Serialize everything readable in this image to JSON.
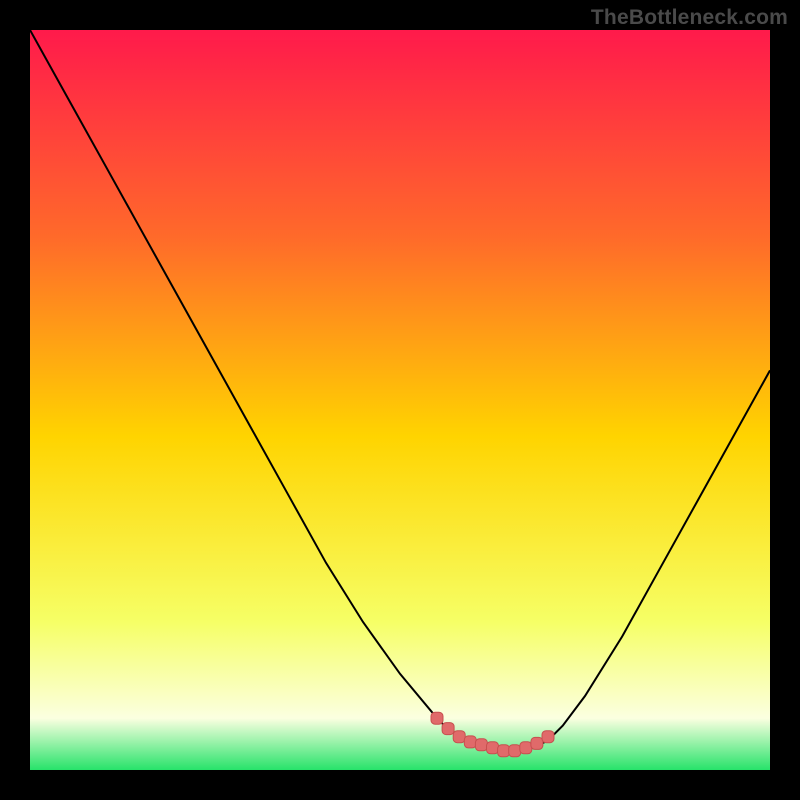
{
  "watermark": "TheBottleneck.com",
  "colors": {
    "bg_black": "#000000",
    "grad_top": "#ff1a4b",
    "grad_mid_upper": "#ff6a2a",
    "grad_mid": "#ffd400",
    "grad_lower": "#f6ff66",
    "grad_bottom_pale": "#fbffe0",
    "grad_bottom_green": "#27e36a",
    "curve_stroke": "#000000",
    "marker_fill": "#e06a6a",
    "marker_stroke": "#c74f4f"
  },
  "chart_data": {
    "type": "line",
    "title": "",
    "xlabel": "",
    "ylabel": "",
    "xlim": [
      0,
      100
    ],
    "ylim": [
      0,
      100
    ],
    "series": [
      {
        "name": "bottleneck-curve",
        "x": [
          0,
          5,
          10,
          15,
          20,
          25,
          30,
          35,
          40,
          45,
          50,
          55,
          56,
          58,
          60,
          62,
          64,
          66,
          68,
          70,
          72,
          75,
          80,
          85,
          90,
          95,
          100
        ],
        "y": [
          100,
          91,
          82,
          73,
          64,
          55,
          46,
          37,
          28,
          20,
          13,
          7,
          6,
          4.5,
          3.4,
          2.8,
          2.6,
          2.6,
          3,
          4,
          6,
          10,
          18,
          27,
          36,
          45,
          54
        ]
      }
    ],
    "markers": {
      "name": "highlight-range",
      "x": [
        55,
        56.5,
        58,
        59.5,
        61,
        62.5,
        64,
        65.5,
        67,
        68.5,
        70
      ],
      "y": [
        7,
        5.6,
        4.5,
        3.8,
        3.4,
        3.0,
        2.6,
        2.6,
        3.0,
        3.6,
        4.5
      ]
    }
  }
}
